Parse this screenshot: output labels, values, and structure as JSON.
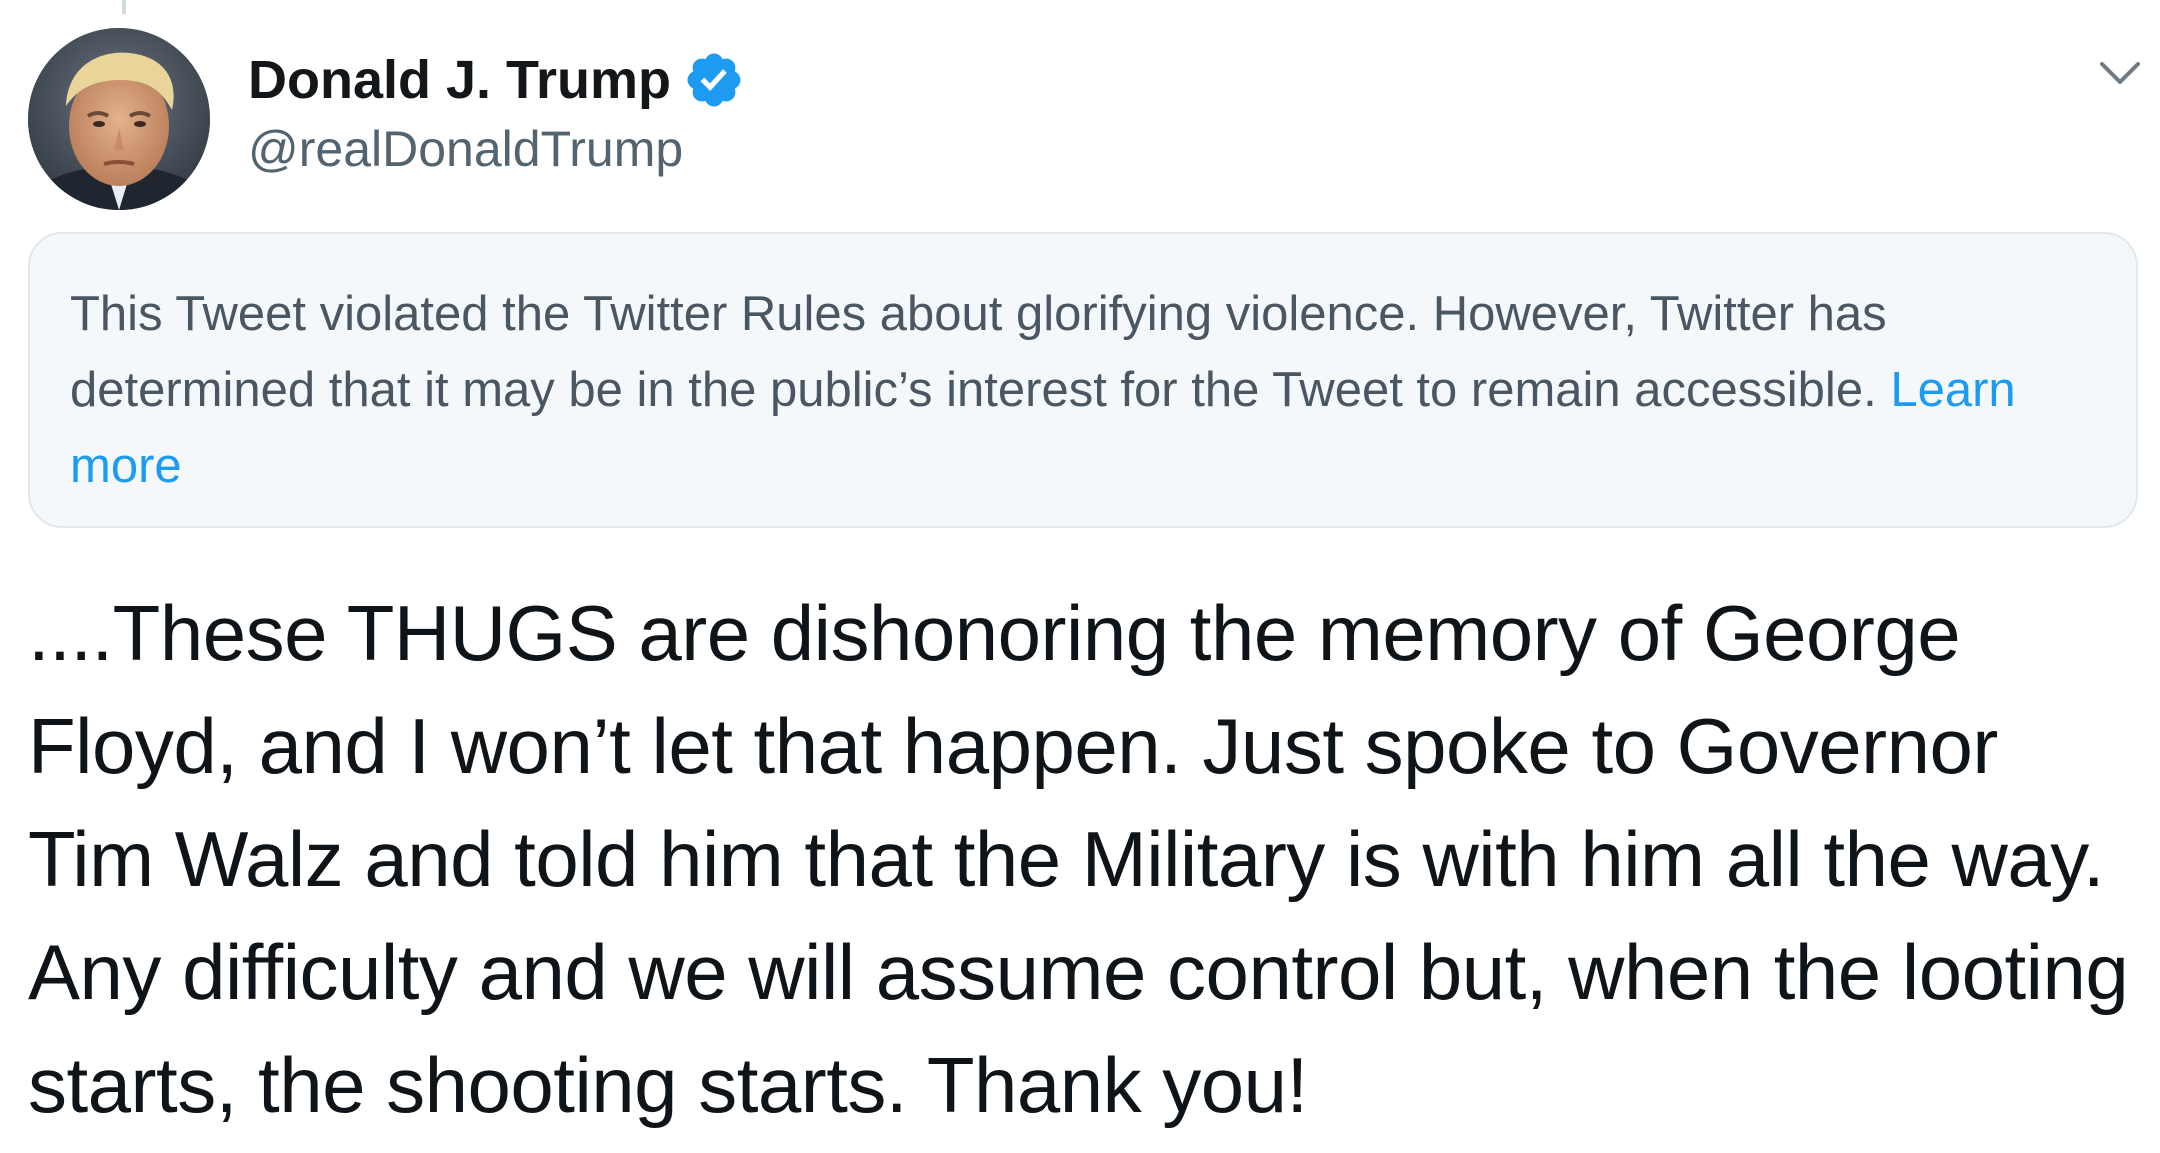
{
  "tweet": {
    "author": {
      "display_name": "Donald J. Trump",
      "handle": "@realDonaldTrump",
      "verified": true,
      "avatar_icon": "profile-photo",
      "verified_icon": "verified-badge-icon"
    },
    "menu_icon": "chevron-down-icon",
    "notice": {
      "text": "This Tweet violated the Twitter Rules about glorifying violence. However, Twitter has determined that it may be in the public’s interest for the Tweet to remain accessible.",
      "link_label": "Learn more"
    },
    "body": "....These THUGS are dishonoring the memory of George Floyd, and I won’t let that happen. Just spoke to Governor Tim Walz and told him that the Military is with him all the way. Any difficulty and we will assume control but, when the looting starts, the shooting starts. Thank you!"
  },
  "colors": {
    "verified_blue": "#1d9bf0",
    "link_blue": "#1d9bf0",
    "notice_background": "#f5f8fa",
    "notice_border": "#e1e8ed",
    "secondary_text": "#536471",
    "primary_text": "#0f1419"
  }
}
